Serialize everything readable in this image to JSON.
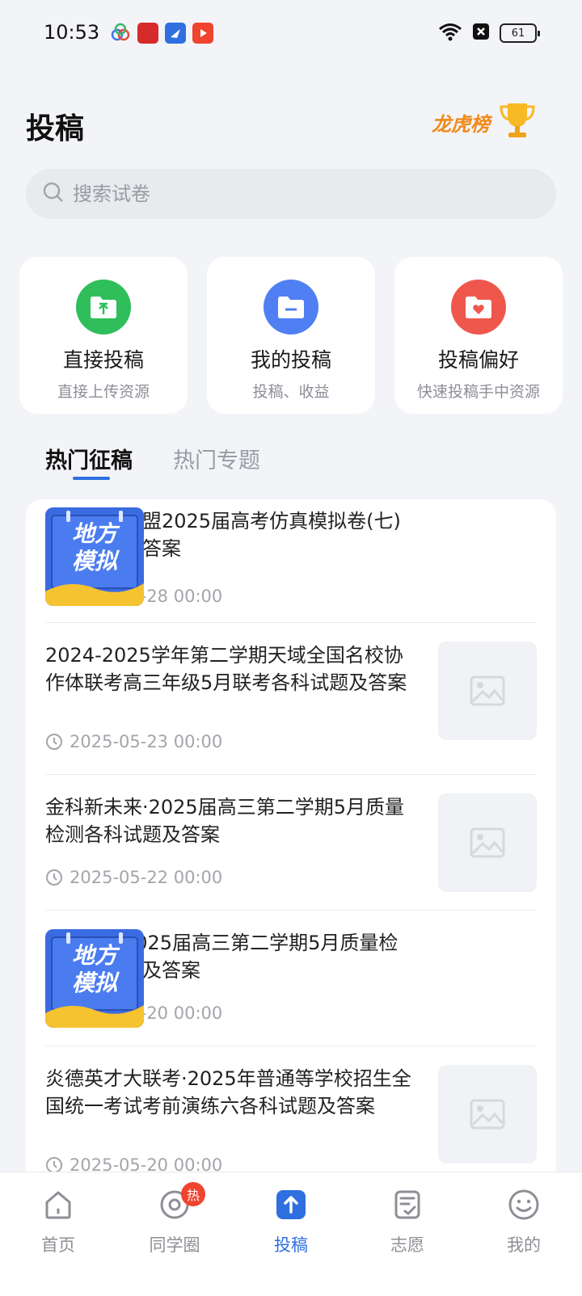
{
  "status_bar": {
    "time": "10:53",
    "battery": "61"
  },
  "header": {
    "title": "投稿",
    "rank_label": "龙虎榜"
  },
  "search": {
    "placeholder": "搜索试卷"
  },
  "quick_actions": [
    {
      "title": "直接投稿",
      "subtitle": "直接上传资源",
      "icon": "folder-upload-icon",
      "color": "#2fbe5a"
    },
    {
      "title": "我的投稿",
      "subtitle": "投稿、收益",
      "icon": "folder-minus-icon",
      "color": "#4f7ff2"
    },
    {
      "title": "投稿偏好",
      "subtitle": "快速投稿手中资源",
      "icon": "folder-heart-icon",
      "color": "#f0574c"
    }
  ],
  "tabs": [
    {
      "label": "热门征稿",
      "active": true
    },
    {
      "label": "热门专题",
      "active": false
    }
  ],
  "list": [
    {
      "title": "名校教研联盟2025届高考仿真模拟卷(七)各科试题及答案",
      "date": "2025-05-28 00:00",
      "thumb": "badge",
      "badge_line1": "地方",
      "badge_line2": "模拟"
    },
    {
      "title": "2024-2025学年第二学期天域全国名校协作体联考高三年级5月联考各科试题及答案",
      "date": "2025-05-23 00:00",
      "thumb": "placeholder"
    },
    {
      "title": "金科新未来·2025届高三第二学期5月质量检测各科试题及答案",
      "date": "2025-05-22 00:00",
      "thumb": "placeholder"
    },
    {
      "title": "华师联盟2025届高三第二学期5月质量检测各科试题及答案",
      "date": "2025-05-20 00:00",
      "thumb": "badge",
      "badge_line1": "地方",
      "badge_line2": "模拟"
    },
    {
      "title": "炎德英才大联考·2025年普通等学校招生全国统一考试考前演练六各科试题及答案",
      "date": "2025-05-20 00:00",
      "thumb": "placeholder"
    }
  ],
  "bottom_nav": [
    {
      "label": "首页",
      "icon": "home-icon",
      "active": false
    },
    {
      "label": "同学圈",
      "icon": "circle-icon",
      "active": false,
      "badge": "热"
    },
    {
      "label": "投稿",
      "icon": "upload-icon",
      "active": true
    },
    {
      "label": "志愿",
      "icon": "checklist-icon",
      "active": false
    },
    {
      "label": "我的",
      "icon": "smile-icon",
      "active": false
    }
  ],
  "colors": {
    "accent": "#2f6fe0",
    "rank": "#f08a1a",
    "background": "#f3f4f8"
  }
}
